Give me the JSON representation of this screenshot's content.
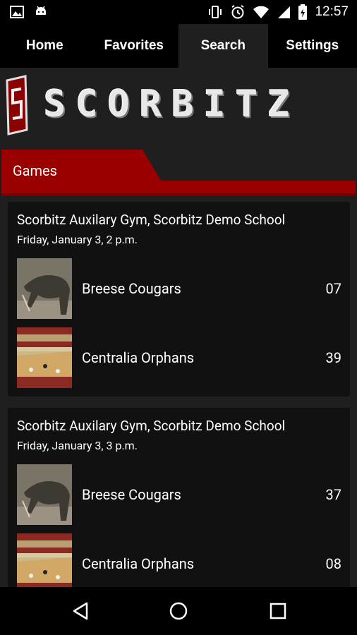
{
  "status": {
    "time": "12:57"
  },
  "tabs": [
    {
      "label": "Home"
    },
    {
      "label": "Favorites"
    },
    {
      "label": "Search"
    },
    {
      "label": "Settings"
    }
  ],
  "logo": {
    "text": "SCORBITZ"
  },
  "section": {
    "title": "Games"
  },
  "games": [
    {
      "venue": "Scorbitz Auxilary Gym, Scorbitz Demo School",
      "datetime": "Friday, January 3, 2 p.m.",
      "teams": [
        {
          "name": "Breese Cougars",
          "score": "07",
          "icon": "komodo-dragon-photo"
        },
        {
          "name": "Centralia Orphans",
          "score": "39",
          "icon": "gym-court-photo"
        }
      ]
    },
    {
      "venue": "Scorbitz Auxilary Gym, Scorbitz Demo School",
      "datetime": "Friday, January 3, 3 p.m.",
      "teams": [
        {
          "name": "Breese Cougars",
          "score": "37",
          "icon": "komodo-dragon-photo"
        },
        {
          "name": "Centralia Orphans",
          "score": "08",
          "icon": "gym-court-photo"
        }
      ]
    }
  ],
  "colors": {
    "accent": "#9b0000",
    "background": "#1f1f1f",
    "card": "#111111"
  }
}
